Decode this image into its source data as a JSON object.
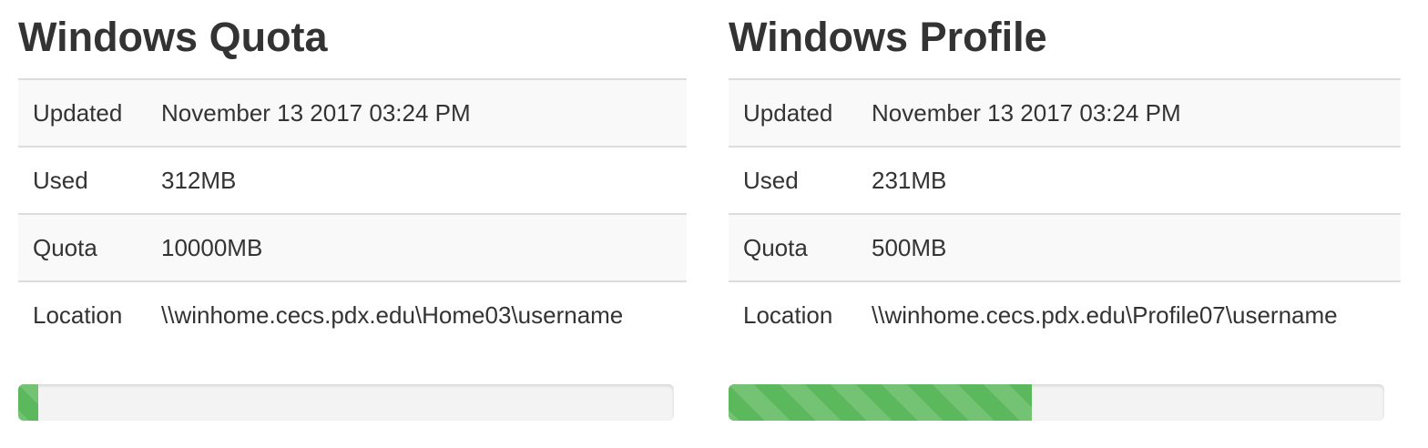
{
  "quota_panel": {
    "title": "Windows Quota",
    "rows": [
      {
        "label": "Updated",
        "value": "November 13 2017 03:24 PM"
      },
      {
        "label": "Used",
        "value": "312MB"
      },
      {
        "label": "Quota",
        "value": "10000MB"
      },
      {
        "label": "Location",
        "value": "\\\\winhome.cecs.pdx.edu\\Home03\\username"
      }
    ],
    "progress_fraction": 0.0312,
    "bar_color": "#5cb85c"
  },
  "profile_panel": {
    "title": "Windows Profile",
    "rows": [
      {
        "label": "Updated",
        "value": "November 13 2017 03:24 PM"
      },
      {
        "label": "Used",
        "value": "231MB"
      },
      {
        "label": "Quota",
        "value": "500MB"
      },
      {
        "label": "Location",
        "value": "\\\\winhome.cecs.pdx.edu\\Profile07\\username"
      }
    ],
    "progress_fraction": 0.462,
    "bar_color": "#5cb85c"
  }
}
